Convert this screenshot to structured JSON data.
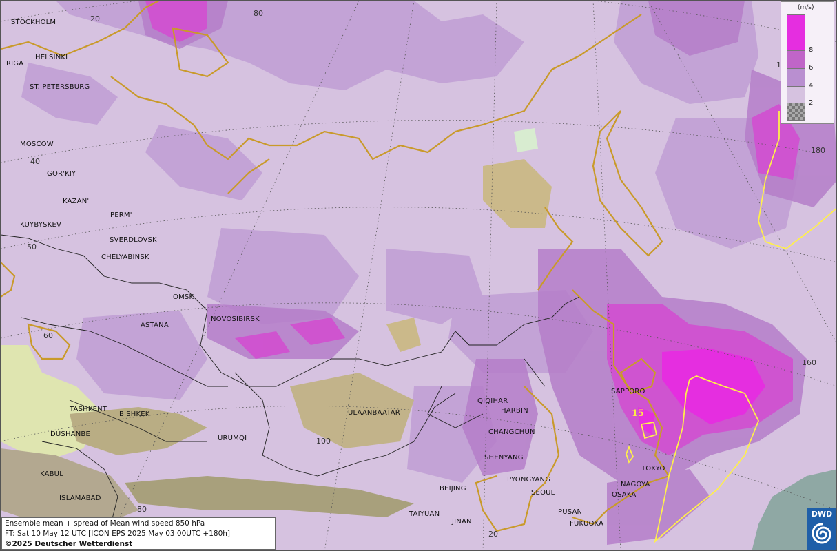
{
  "map": {
    "colors": {
      "base": "#d6c2e0",
      "level4": "#c3a3d6",
      "level6": "#b57ec9",
      "level8": "#d24fd0",
      "peak": "#e52ee0",
      "coast": "#c99a2a",
      "border": "#222222",
      "contour15": "#fff04a",
      "ocean_low": "#8fa8a4"
    },
    "cities": [
      {
        "id": "stockholm",
        "label": "STOCKHOLM"
      },
      {
        "id": "helsinki",
        "label": "HELSINKI"
      },
      {
        "id": "riga",
        "label": "RIGA"
      },
      {
        "id": "st-petersburg",
        "label": "ST. PETERSBURG"
      },
      {
        "id": "moscow",
        "label": "MOSCOW"
      },
      {
        "id": "gorkiy",
        "label": "GOR'KIY"
      },
      {
        "id": "kazan",
        "label": "KAZAN'"
      },
      {
        "id": "perm",
        "label": "PERM'"
      },
      {
        "id": "kuybyshev",
        "label": "KUYBYSKEV"
      },
      {
        "id": "sverdlovsk",
        "label": "SVERDLOVSK"
      },
      {
        "id": "chelyabinsk",
        "label": "CHELYABINSK"
      },
      {
        "id": "omsk",
        "label": "OMSK"
      },
      {
        "id": "astana",
        "label": "ASTANA"
      },
      {
        "id": "novosibirsk",
        "label": "NOVOSIBIRSK"
      },
      {
        "id": "tashkent",
        "label": "TASHKENT"
      },
      {
        "id": "bishkek",
        "label": "BISHKEK"
      },
      {
        "id": "dushanbe",
        "label": "DUSHANBE"
      },
      {
        "id": "urumqi",
        "label": "URUMQI"
      },
      {
        "id": "kabul",
        "label": "KABUL"
      },
      {
        "id": "islamabad",
        "label": "ISLAMABAD"
      },
      {
        "id": "ulaanbaatar",
        "label": "ULAANBAATAR"
      },
      {
        "id": "qiqihar",
        "label": "QIQIHAR"
      },
      {
        "id": "harbin",
        "label": "HARBIN"
      },
      {
        "id": "changchun",
        "label": "CHANGCHUN"
      },
      {
        "id": "shenyang",
        "label": "SHENYANG"
      },
      {
        "id": "pyongyang",
        "label": "PYONGYANG"
      },
      {
        "id": "seoul",
        "label": "SEOUL"
      },
      {
        "id": "beijing",
        "label": "BEIJING"
      },
      {
        "id": "taiyuan",
        "label": "TAIYUAN"
      },
      {
        "id": "jinan",
        "label": "JINAN"
      },
      {
        "id": "pusan",
        "label": "PUSAN"
      },
      {
        "id": "fukuoka",
        "label": "FUKUOKA"
      },
      {
        "id": "sapporo",
        "label": "SAPPORO"
      },
      {
        "id": "tokyo",
        "label": "TOKYO"
      },
      {
        "id": "nagoya",
        "label": "NAGOYA"
      },
      {
        "id": "osaka",
        "label": "OSAKA"
      }
    ],
    "grid_labels": [
      {
        "id": "lon-20-top",
        "label": "20"
      },
      {
        "id": "lon-80-top",
        "label": "80"
      },
      {
        "id": "lat-40",
        "label": "40"
      },
      {
        "id": "lat-50",
        "label": "50"
      },
      {
        "id": "lat-60",
        "label": "60"
      },
      {
        "id": "lon-100",
        "label": "100"
      },
      {
        "id": "lon-80-bottom",
        "label": "80"
      },
      {
        "id": "lon-20-bottom",
        "label": "20"
      },
      {
        "id": "lon-180",
        "label": "180"
      },
      {
        "id": "lon-160",
        "label": "160"
      },
      {
        "id": "lat-1-edge",
        "label": "1"
      }
    ],
    "contour_label": "15"
  },
  "legend": {
    "unit": "(m/s)",
    "levels": [
      "8",
      "6",
      "4",
      "2"
    ],
    "colors": [
      "#e52ee0",
      "#c065c8",
      "#b98fd0",
      "#d6c2e0"
    ]
  },
  "info": {
    "line1": "Ensemble mean + spread of Mean wind speed 850 hPa",
    "line2": "FT: Sat 10 May 12 UTC [ICON EPS 2025 May 03 00UTC +180h]",
    "copyright": "©2025 Deutscher Wetterdienst"
  },
  "logo": {
    "text": "DWD"
  }
}
